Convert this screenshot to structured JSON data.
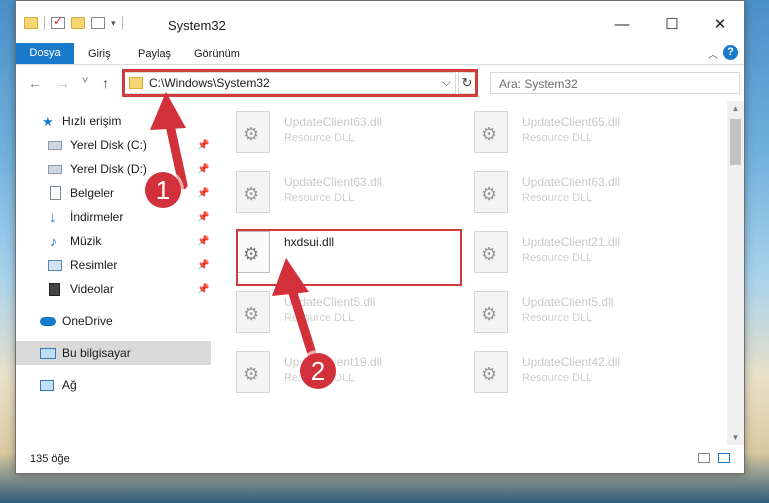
{
  "window": {
    "title": "System32",
    "controls": {
      "minimize": "—",
      "maximize": "☐",
      "close": "✕"
    }
  },
  "ribbon": {
    "tabs": [
      "Dosya",
      "Giriş",
      "Paylaş",
      "Görünüm"
    ],
    "help": "?"
  },
  "address": {
    "path": "C:\\Windows\\System32",
    "refresh": "↻",
    "search_placeholder": "Ara: System32"
  },
  "nav": {
    "back": "←",
    "forward": "→",
    "recent": "˅",
    "up": "↑"
  },
  "sidebar": {
    "items": [
      {
        "label": "Hızlı erişim",
        "icon": "star-icon",
        "pinned": false
      },
      {
        "label": "Yerel Disk (C:)",
        "icon": "drive-icon",
        "pinned": true
      },
      {
        "label": "Yerel Disk (D:)",
        "icon": "drive-icon",
        "pinned": true
      },
      {
        "label": "Belgeler",
        "icon": "documents-icon",
        "pinned": true
      },
      {
        "label": "İndirmeler",
        "icon": "download-icon",
        "pinned": true
      },
      {
        "label": "Müzik",
        "icon": "music-icon",
        "pinned": true
      },
      {
        "label": "Resimler",
        "icon": "pictures-icon",
        "pinned": true
      },
      {
        "label": "Videolar",
        "icon": "videos-icon",
        "pinned": true
      },
      {
        "label": "OneDrive",
        "icon": "cloud-icon",
        "pinned": false
      },
      {
        "label": "Bu bilgisayar",
        "icon": "computer-icon",
        "pinned": false,
        "selected": true
      },
      {
        "label": "Ağ",
        "icon": "network-icon",
        "pinned": false
      }
    ]
  },
  "files": [
    {
      "name": "UpdateClient63.dll",
      "type": "Resource DLL"
    },
    {
      "name": "UpdateClient65.dll",
      "type": "Resource DLL"
    },
    {
      "name": "UpdateClient63.dll",
      "type": "Resource DLL"
    },
    {
      "name": "UpdateClient63.dll",
      "type": "Resource DLL"
    },
    {
      "name": "hxdsui.dll",
      "type": ""
    },
    {
      "name": "UpdateClient21.dll",
      "type": "Resource DLL"
    },
    {
      "name": "UpdateClient5.dll",
      "type": "Resource DLL"
    },
    {
      "name": "UpdateClient5.dll",
      "type": "Resource DLL"
    },
    {
      "name": "UpdateClient19.dll",
      "type": "Resource DLL"
    },
    {
      "name": "UpdateClient42.dll",
      "type": "Resource DLL"
    }
  ],
  "status": {
    "count": "135 öğe"
  },
  "callouts": {
    "one": "1",
    "two": "2"
  },
  "colors": {
    "accent": "#1979ca",
    "highlight": "#d03c3c",
    "callout": "#d2303a"
  }
}
